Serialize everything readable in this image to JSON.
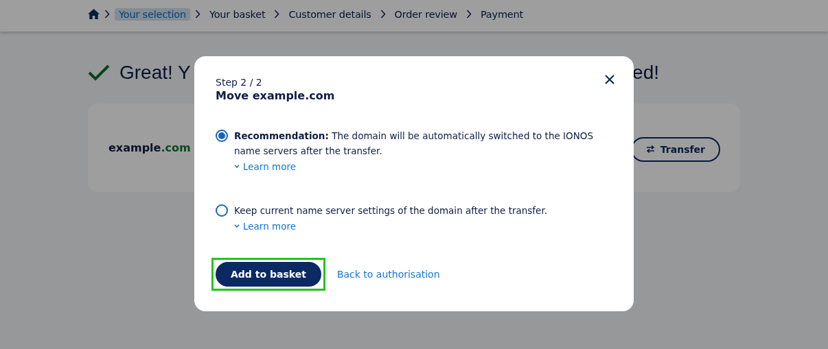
{
  "breadcrumb": [
    {
      "label": "Your selection",
      "selected": true
    },
    {
      "label": "Your basket",
      "selected": false
    },
    {
      "label": "Customer details",
      "selected": false
    },
    {
      "label": "Order review",
      "selected": false
    },
    {
      "label": "Payment",
      "selected": false
    }
  ],
  "heading": {
    "visible_start": "Great! Y",
    "visible_end": "ed!"
  },
  "domain": {
    "name": "example",
    "tld": ".com"
  },
  "transfer_button": "Transfer",
  "modal": {
    "step": "Step 2 / 2",
    "title": "Move example.com",
    "options": [
      {
        "selected": true,
        "text": "**Recommendation:** The domain will be automatically switched to the IONOS name servers after the transfer.",
        "link": "Learn more"
      },
      {
        "selected": false,
        "text": "Keep current name server settings of the domain after the transfer.",
        "link": "Learn more"
      }
    ],
    "primary_button": {
      "label": "Add to basket",
      "highlighted": true
    },
    "secondary_link": "Back to authorisation"
  }
}
